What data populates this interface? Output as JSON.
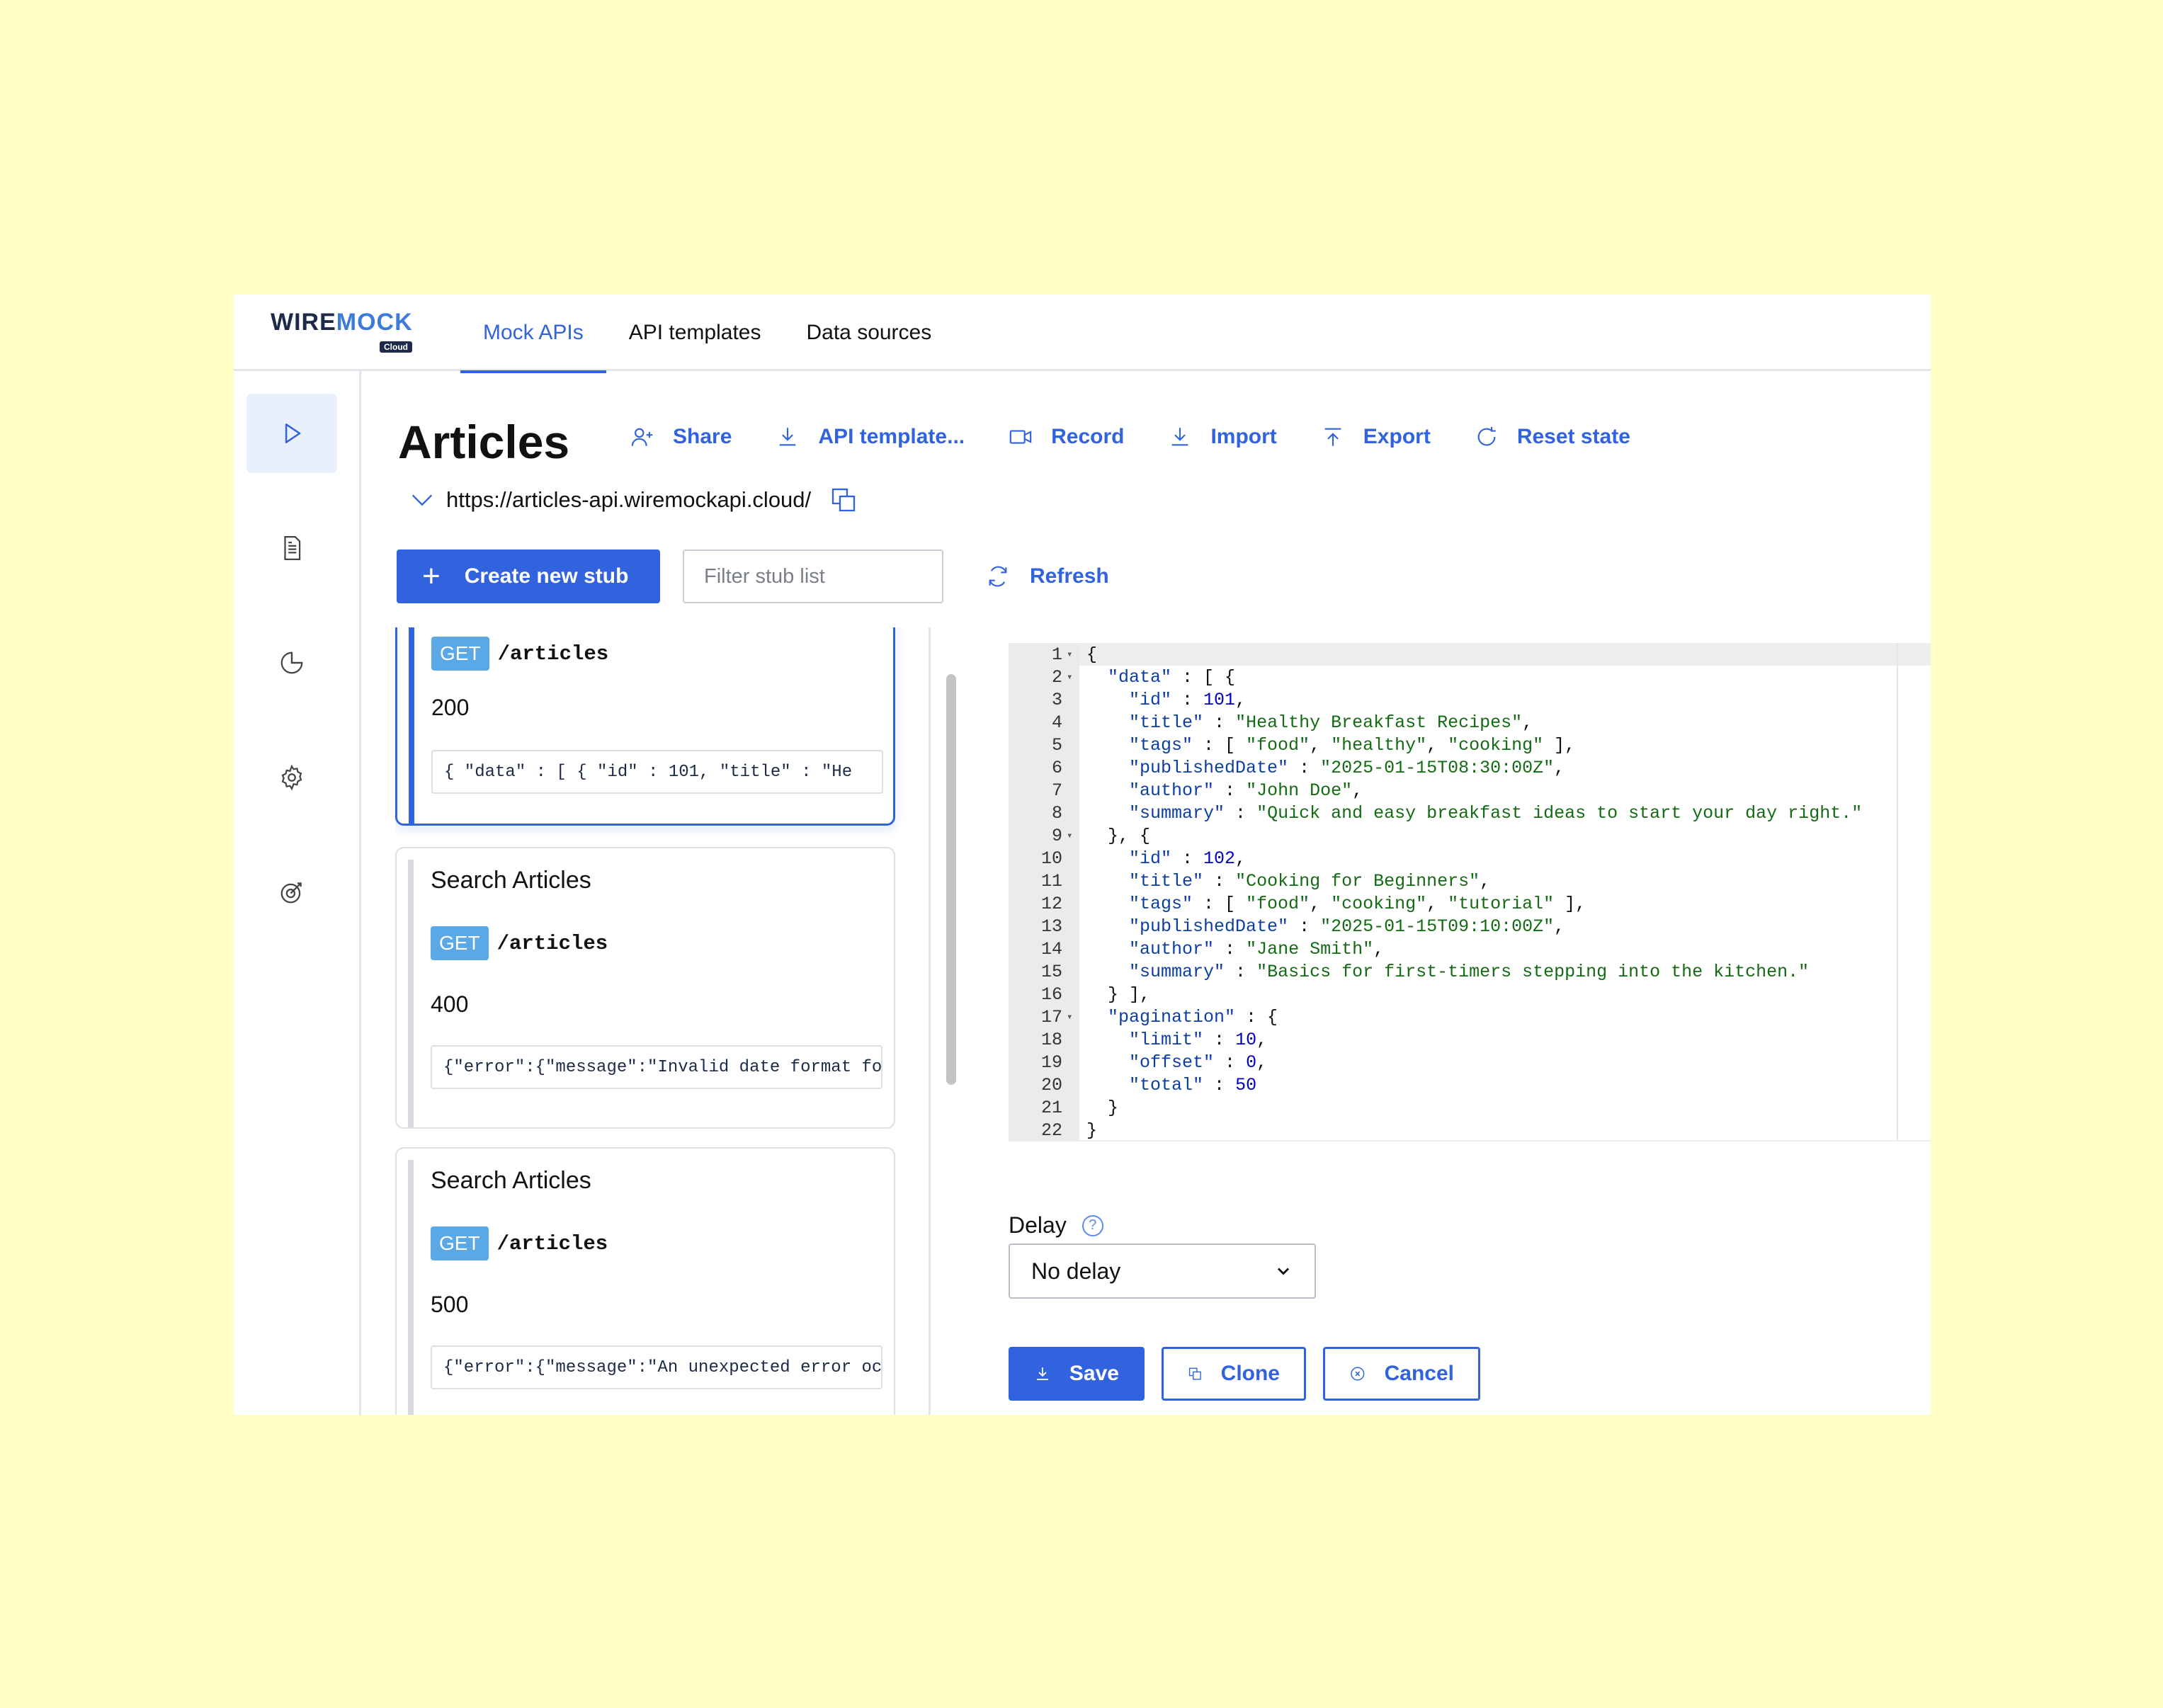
{
  "logo": {
    "wire": "WIRE",
    "mock": "MOCK",
    "cloud": "Cloud"
  },
  "nav": [
    {
      "label": "Mock APIs",
      "active": true
    },
    {
      "label": "API templates",
      "active": false
    },
    {
      "label": "Data sources",
      "active": false
    }
  ],
  "rail": [
    {
      "icon": "play-icon",
      "active": true
    },
    {
      "icon": "document-icon",
      "active": false
    },
    {
      "icon": "pie-chart-icon",
      "active": false
    },
    {
      "icon": "gear-icon",
      "active": false
    },
    {
      "icon": "target-icon",
      "active": false
    }
  ],
  "page": {
    "title": "Articles",
    "url": "https://articles-api.wiremockapi.cloud/"
  },
  "actions": {
    "share": "Share",
    "api_template": "API template...",
    "record": "Record",
    "import": "Import",
    "export": "Export",
    "reset_state": "Reset state"
  },
  "toolbar": {
    "create_label": "Create new stub",
    "filter_placeholder": "Filter stub list",
    "refresh_label": "Refresh"
  },
  "stubs": [
    {
      "name": "",
      "method": "GET",
      "path": "/articles",
      "status": "200",
      "body": "{ \"data\" : [ { \"id\" : 101, \"title\" : \"He",
      "selected": true
    },
    {
      "name": "Search Articles",
      "method": "GET",
      "path": "/articles",
      "status": "400",
      "body": "{\"error\":{\"message\":\"Invalid date format fo",
      "selected": false
    },
    {
      "name": "Search Articles",
      "method": "GET",
      "path": "/articles",
      "status": "500",
      "body": "{\"error\":{\"message\":\"An unexpected error oc",
      "selected": false
    }
  ],
  "code": {
    "lines": [
      "{",
      "  \"data\" : [ {",
      "    \"id\" : 101,",
      "    \"title\" : \"Healthy Breakfast Recipes\",",
      "    \"tags\" : [ \"food\", \"healthy\", \"cooking\" ],",
      "    \"publishedDate\" : \"2025-01-15T08:30:00Z\",",
      "    \"author\" : \"John Doe\",",
      "    \"summary\" : \"Quick and easy breakfast ideas to start your day right.\"",
      "  }, {",
      "    \"id\" : 102,",
      "    \"title\" : \"Cooking for Beginners\",",
      "    \"tags\" : [ \"food\", \"cooking\", \"tutorial\" ],",
      "    \"publishedDate\" : \"2025-01-15T09:10:00Z\",",
      "    \"author\" : \"Jane Smith\",",
      "    \"summary\" : \"Basics for first-timers stepping into the kitchen.\"",
      "  } ],",
      "  \"pagination\" : {",
      "    \"limit\" : 10,",
      "    \"offset\" : 0,",
      "    \"total\" : 50",
      "  }",
      "}"
    ],
    "fold_lines": [
      1,
      2,
      9,
      17
    ]
  },
  "delay": {
    "label": "Delay",
    "help": "?",
    "value": "No delay"
  },
  "footer": {
    "save": "Save",
    "clone": "Clone",
    "cancel": "Cancel"
  },
  "colors": {
    "accent": "#3263de",
    "method_badge": "#5aa9e6",
    "page_background": "#ffffc4"
  }
}
